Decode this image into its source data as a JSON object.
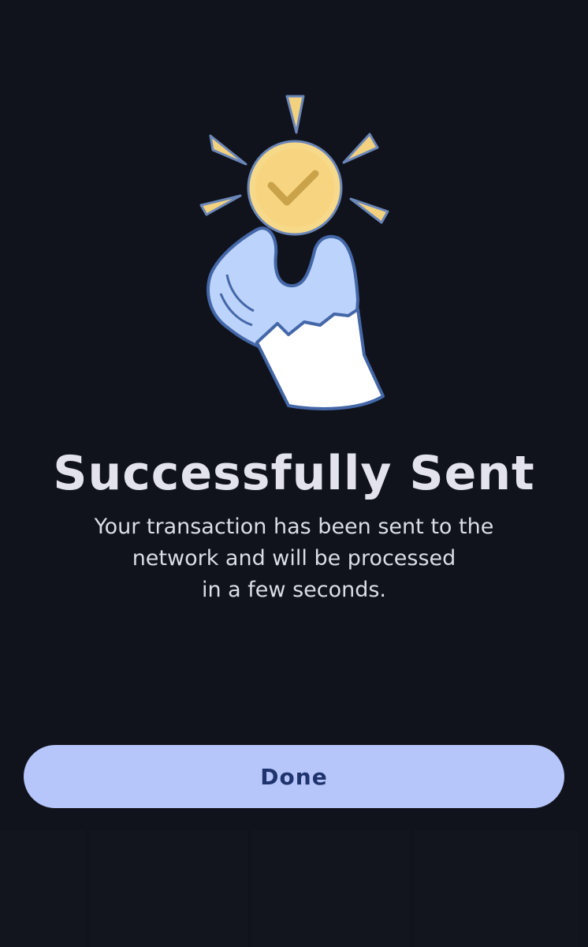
{
  "illustration": {
    "icon": "hand-holding-check-coin-icon",
    "colors": {
      "coin": "#f7d98a",
      "check": "#c9a24a",
      "rays": "#f3d27f",
      "hand": "#bcd3fb",
      "outline": "#4467a8",
      "sleeve": "#ffffff"
    }
  },
  "title": "Successfully Sent",
  "message": {
    "line1": "Your transaction has been sent to the",
    "line2": "network and will be processed",
    "line3": "in a few seconds."
  },
  "done_button": {
    "label": "Done",
    "background": "#b6c5fa",
    "text_color": "#1f336c"
  },
  "theme": {
    "background": "#10131b",
    "title_color": "#e3e3ee",
    "message_color": "#dcdde6"
  }
}
